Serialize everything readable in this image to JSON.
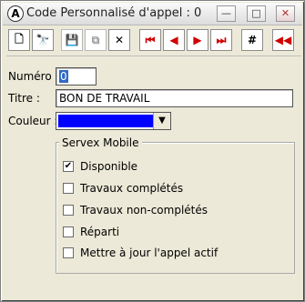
{
  "window": {
    "title": "Code Personnalisé d'appel : 0",
    "app_icon_glyph": "A",
    "buttons": {
      "minimize": "—",
      "maximize": "□",
      "close": "✕"
    }
  },
  "toolbar": {
    "items": [
      {
        "name": "new-icon",
        "glyph": "🗋"
      },
      {
        "name": "find-icon",
        "glyph": "🔭"
      },
      {
        "name": "save-icon",
        "glyph": "💾",
        "disabled": true
      },
      {
        "name": "copy-icon",
        "glyph": "⧉",
        "disabled": true
      },
      {
        "name": "delete-icon",
        "glyph": "✕"
      },
      {
        "name": "first-icon",
        "glyph": "⏮"
      },
      {
        "name": "prev-icon",
        "glyph": "◀"
      },
      {
        "name": "next-icon",
        "glyph": "▶"
      },
      {
        "name": "last-icon",
        "glyph": "⏭"
      },
      {
        "name": "number-icon",
        "glyph": "#"
      },
      {
        "name": "back-icon",
        "glyph": "◀◀"
      }
    ]
  },
  "form": {
    "numero_label": "Numéro :",
    "numero_value": "0",
    "titre_label": "Titre :",
    "titre_value": "BON DE TRAVAIL",
    "couleur_label": "Couleur :",
    "couleur_value": "#0000ff",
    "combo_arrow": "▼"
  },
  "group": {
    "legend": "Servex Mobile",
    "options": [
      {
        "label": "Disponible",
        "checked": true
      },
      {
        "label": "Travaux complétés",
        "checked": false
      },
      {
        "label": "Travaux non-complétés",
        "checked": false
      },
      {
        "label": "Réparti",
        "checked": false
      },
      {
        "label": "Mettre à jour l'appel actif",
        "checked": false
      }
    ]
  }
}
